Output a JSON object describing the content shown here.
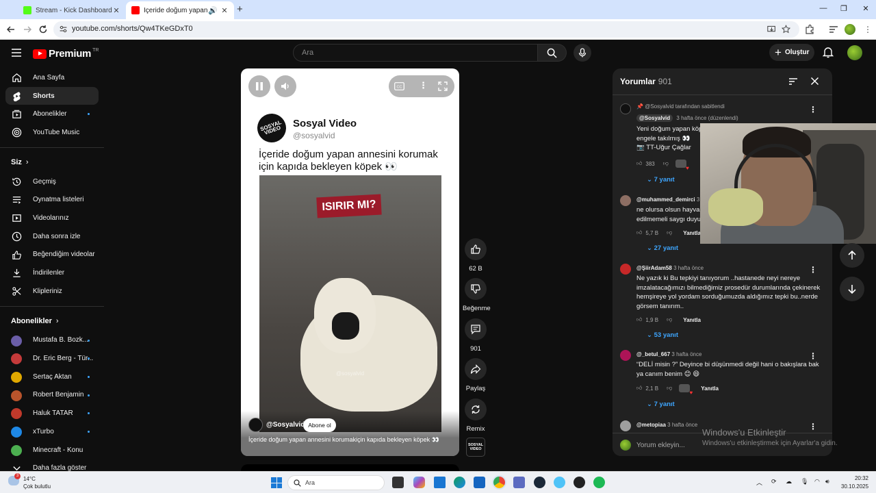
{
  "browser": {
    "tabs": [
      {
        "title": "Stream - Kick Dashboard",
        "active": false,
        "favicon_color": "#53fc18"
      },
      {
        "title": "İçeride doğum yapan annesi",
        "active": true,
        "favicon_color": "#ff0000"
      }
    ],
    "url": "youtube.com/shorts/Qw4TKeGDxT0"
  },
  "masthead": {
    "logo_text": "Premium",
    "logo_suffix": "TR",
    "search_placeholder": "Ara",
    "create_label": "Oluştur"
  },
  "sidebar": {
    "main": [
      {
        "label": "Ana Sayfa",
        "icon": "home-icon",
        "active": false
      },
      {
        "label": "Shorts",
        "icon": "shorts-icon",
        "active": true
      },
      {
        "label": "Abonelikler",
        "icon": "subscriptions-icon",
        "active": false,
        "dot": true
      },
      {
        "label": "YouTube Music",
        "icon": "music-icon",
        "active": false
      }
    ],
    "you_header": "Siz",
    "you": [
      {
        "label": "Geçmiş",
        "icon": "history-icon"
      },
      {
        "label": "Oynatma listeleri",
        "icon": "playlist-icon"
      },
      {
        "label": "Videolarınız",
        "icon": "your-videos-icon"
      },
      {
        "label": "Daha sonra izle",
        "icon": "watch-later-icon"
      },
      {
        "label": "Beğendiğim videolar",
        "icon": "liked-icon"
      },
      {
        "label": "İndirilenler",
        "icon": "download-icon"
      },
      {
        "label": "Klipleriniz",
        "icon": "scissors-icon"
      }
    ],
    "subs_header": "Abonelikler",
    "subs": [
      {
        "label": "Mustafa B. Bozk...",
        "color": "#6b5ea8"
      },
      {
        "label": "Dr. Eric Berg - Tür...",
        "color": "#c43a3a"
      },
      {
        "label": "Sertaç Aktan",
        "color": "#e0a800"
      },
      {
        "label": "Robert Benjamin",
        "color": "#b8542c"
      },
      {
        "label": "Haluk TATAR",
        "color": "#c0392b"
      },
      {
        "label": "xTurbo",
        "color": "#1e88e5"
      },
      {
        "label": "Minecraft - Konu",
        "color": "#4caf50"
      }
    ],
    "more_label": "Daha fazla göster"
  },
  "short": {
    "brand_name": "Sosyal Video",
    "brand_handle": "@sosyalvid",
    "brand_logo_text": "SOSYAL VIDEO",
    "caption": "İçeride doğum yapan annesini korumak için kapıda bekleyen köpek 👀",
    "sign_text": "ISIRIR MI?",
    "watermark": "@sosyalvid",
    "channel": "@Sosyalvid",
    "subscribe_label": "Abone ol",
    "bottom_caption": "İçeride doğum yapan annesini korumakiçin kapıda bekleyen köpek 👀"
  },
  "actions": {
    "like_count": "62 B",
    "dislike_label": "Beğenme",
    "comment_count": "901",
    "share_label": "Paylaş",
    "remix_label": "Remix"
  },
  "comments": {
    "title": "Yorumlar",
    "count": "901",
    "pinned_text": "@Sosyalvid tarafından sabitlendi",
    "items": [
      {
        "author": "@Sosyalvid",
        "time": "3 hafta önce (düzenlendi)",
        "lines": [
          "Yeni doğum yapan köp",
          "engele takılmış 👀",
          "📷 TT-Uğur Çağlar"
        ],
        "likes": "383",
        "replies": "7 yanıt",
        "avatar_color": "#111111"
      },
      {
        "author": "@muhammed_demirci",
        "time": "3",
        "lines": [
          "ne olursa olsun hayvan",
          "edilmemeli saygı duyu"
        ],
        "likes": "5,7 B",
        "reply_label": "Yanıtla",
        "replies": "27 yanıt",
        "avatar_color": "#8d6e63"
      },
      {
        "author": "@ŞiirAdam58",
        "time": "3 hafta önce",
        "lines": [
          "Ne yazık ki Bu tepkiyi tanıyorum ..hastanede neyi nereye",
          "imzalatacağımızı bilmediğimiz prosedür durumlarında çekinerek",
          "hemşireye yol yordam sorduğumuzda aldığımız tepki bu..nerde",
          "görsem tanırım.."
        ],
        "likes": "1,9 B",
        "reply_label": "Yanıtla",
        "replies": "53 yanıt",
        "avatar_color": "#c62828"
      },
      {
        "author": "@_betul_667",
        "time": "3 hafta önce",
        "lines": [
          "“DELİ misin ?” Deyince bi düşünmedi değil hani o bakışlara bak",
          "ya canım benim 😊 😄"
        ],
        "likes": "2,1 B",
        "reply_label": "Yanıtla",
        "replies": "7 yanıt",
        "avatar_color": "#ad1457"
      },
      {
        "author": "@metopiaa",
        "time": "3 hafta önce",
        "lines": [],
        "avatar_color": "#9e9e9e"
      }
    ],
    "add_placeholder": "Yorum ekleyin..."
  },
  "windows_activation": {
    "title": "Windows'u Etkinleştir",
    "subtitle": "Windows'u etkinleştirmek için Ayarlar'a gidin."
  },
  "taskbar": {
    "weather_badge": "3",
    "temperature": "14°C",
    "condition": "Çok bulutlu",
    "search_placeholder": "Ara",
    "time": "20:32",
    "date": "30.10.2025"
  }
}
